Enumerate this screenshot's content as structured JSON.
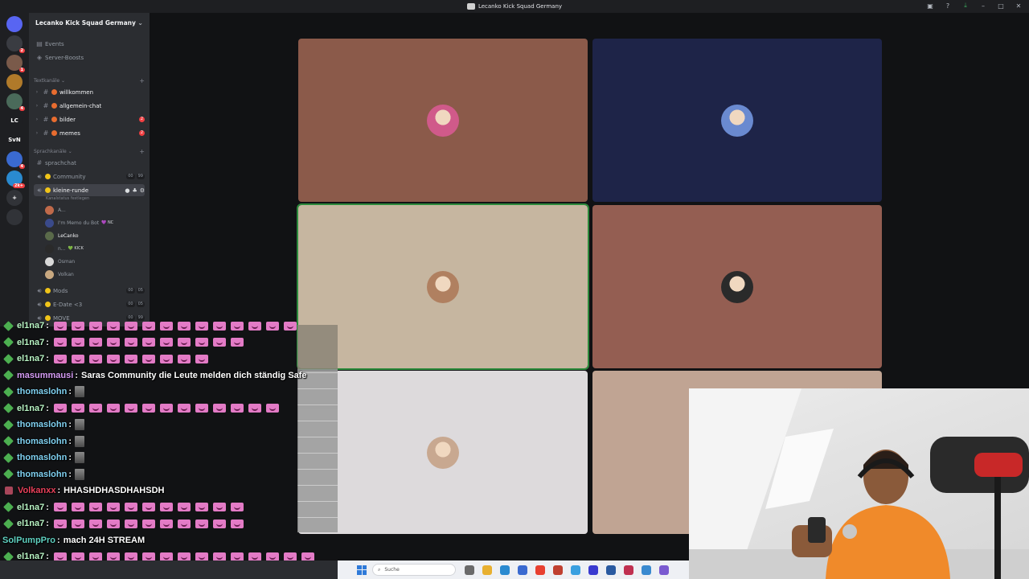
{
  "window": {
    "title": "Lecanko Kick Squad Germany",
    "controls": [
      "inbox-icon",
      "help-icon",
      "download-icon",
      "minimize-icon",
      "maximize-icon",
      "close-icon"
    ]
  },
  "rail": {
    "servers": [
      {
        "label": "",
        "color": "#5865f2",
        "badge": ""
      },
      {
        "label": "",
        "color": "#3a3c42",
        "badge": "2"
      },
      {
        "label": "",
        "color": "#7a5a4a",
        "badge": "1"
      },
      {
        "label": "",
        "color": "#b07a2a",
        "badge": ""
      },
      {
        "label": "",
        "color": "#4a6a5a",
        "badge": "4"
      },
      {
        "label": "LC",
        "color": "#1e1f22",
        "badge": ""
      },
      {
        "label": "SvN",
        "color": "#1e1f22",
        "badge": ""
      },
      {
        "label": "",
        "color": "#3a6ad0",
        "badge": "4"
      },
      {
        "label": "",
        "color": "#2a8ad0",
        "badge": "2k+"
      },
      {
        "label": "+",
        "color": "#313338",
        "badge": ""
      },
      {
        "label": "",
        "color": "#313338",
        "badge": ""
      }
    ]
  },
  "sidebar": {
    "guild_name": "Lecanko Kick Squad Germany",
    "top_links": [
      "Events",
      "Server-Boosts"
    ],
    "text_category": "Textkanäle",
    "text_channels": [
      {
        "name": "willkommen",
        "badge": ""
      },
      {
        "name": "allgemein-chat",
        "badge": ""
      },
      {
        "name": "bilder",
        "badge": "2"
      },
      {
        "name": "memes",
        "badge": "2"
      }
    ],
    "voice_category": "Sprachkanäle",
    "voice_text_channel": "sprachchat",
    "voice_channels": [
      {
        "name": "Community",
        "count": [
          "00",
          "99"
        ]
      },
      {
        "name": "kleine-runde",
        "active": true,
        "status": "Kanalstatus festlegen"
      },
      {
        "name": "Mods",
        "count": [
          "00",
          "05"
        ]
      },
      {
        "name": "E-Date <3",
        "count": [
          "00",
          "05"
        ]
      },
      {
        "name": "MOVE",
        "count": [
          "00",
          "99"
        ]
      }
    ],
    "voice_users": [
      {
        "name": "A...",
        "tag": "",
        "color": "#c06a4a"
      },
      {
        "name": "I'm Memo du Bot",
        "tag": "💜 NC",
        "color": "#3a4a8a"
      },
      {
        "name": "LeCanko",
        "tag": "",
        "color": "#5a6a4a"
      },
      {
        "name": "n...",
        "tag": "💚 KICK",
        "color": "#2a2a2a"
      },
      {
        "name": "Osman",
        "tag": "",
        "color": "#d8d8d8"
      },
      {
        "name": "Volkan",
        "tag": "",
        "color": "#c8a880"
      }
    ]
  },
  "tiles": [
    {
      "bg": "#8b5a4a",
      "avatar": "#d05a8a",
      "speaking": false
    },
    {
      "bg": "#1e2448",
      "avatar": "#6a8ad0",
      "speaking": false
    },
    {
      "bg": "#c6b6a0",
      "avatar": "#b08060",
      "speaking": true
    },
    {
      "bg": "#945e52",
      "avatar": "#2a2a2a",
      "speaking": false
    },
    {
      "bg": "#dddadc",
      "avatar": "#c8a890",
      "speaking": false
    },
    {
      "bg": "#c0a493",
      "avatar": "",
      "speaking": false
    }
  ],
  "chat": {
    "messages": [
      {
        "user": "el1na7",
        "color": "#b9f5c5",
        "text": "",
        "emotes": 14,
        "gifs": 0,
        "badge": "dia"
      },
      {
        "user": "el1na7",
        "color": "#b9f5c5",
        "text": "",
        "emotes": 11,
        "gifs": 0,
        "badge": "dia"
      },
      {
        "user": "el1na7",
        "color": "#b9f5c5",
        "text": "",
        "emotes": 9,
        "gifs": 0,
        "badge": "dia"
      },
      {
        "user": "masummausi",
        "color": "#d59cf5",
        "text": "Saras Community die Leute melden dich ständig Safe",
        "emotes": 0,
        "gifs": 0,
        "badge": "dia"
      },
      {
        "user": "thomaslohn",
        "color": "#7fd0f0",
        "text": "",
        "emotes": 0,
        "gifs": 1,
        "badge": "dia"
      },
      {
        "user": "el1na7",
        "color": "#b9f5c5",
        "text": "",
        "emotes": 13,
        "gifs": 0,
        "badge": "dia"
      },
      {
        "user": "thomaslohn",
        "color": "#7fd0f0",
        "text": "",
        "emotes": 0,
        "gifs": 1,
        "badge": "dia"
      },
      {
        "user": "thomaslohn",
        "color": "#7fd0f0",
        "text": "",
        "emotes": 0,
        "gifs": 1,
        "badge": "dia"
      },
      {
        "user": "thomaslohn",
        "color": "#7fd0f0",
        "text": "",
        "emotes": 0,
        "gifs": 1,
        "badge": "dia"
      },
      {
        "user": "thomaslohn",
        "color": "#7fd0f0",
        "text": "",
        "emotes": 0,
        "gifs": 1,
        "badge": "dia"
      },
      {
        "user": "Volkanxx",
        "color": "#e8405a",
        "text": "HHASHDHASDHAHSDH",
        "emotes": 0,
        "gifs": 0,
        "badge": "gift"
      },
      {
        "user": "el1na7",
        "color": "#b9f5c5",
        "text": "",
        "emotes": 11,
        "gifs": 0,
        "badge": "dia"
      },
      {
        "user": "el1na7",
        "color": "#b9f5c5",
        "text": "",
        "emotes": 11,
        "gifs": 0,
        "badge": "dia"
      },
      {
        "user": "SolPumpPro",
        "color": "#5fd0c0",
        "text": "mach 24H STREAM",
        "emotes": 0,
        "gifs": 0,
        "badge": "none"
      },
      {
        "user": "el1na7",
        "color": "#b9f5c5",
        "text": "",
        "emotes": 15,
        "gifs": 0,
        "badge": "dia"
      }
    ]
  },
  "taskbar": {
    "search_placeholder": "Suche",
    "apps": [
      "#6a6a6a",
      "#e8b030",
      "#2a8ad0",
      "#3a6ad0",
      "#e84030",
      "#c04030",
      "#3aa0e0",
      "#3a3ad0",
      "#2a5aa0",
      "#c03050",
      "#3a8ad0",
      "#7a5ad0"
    ]
  }
}
